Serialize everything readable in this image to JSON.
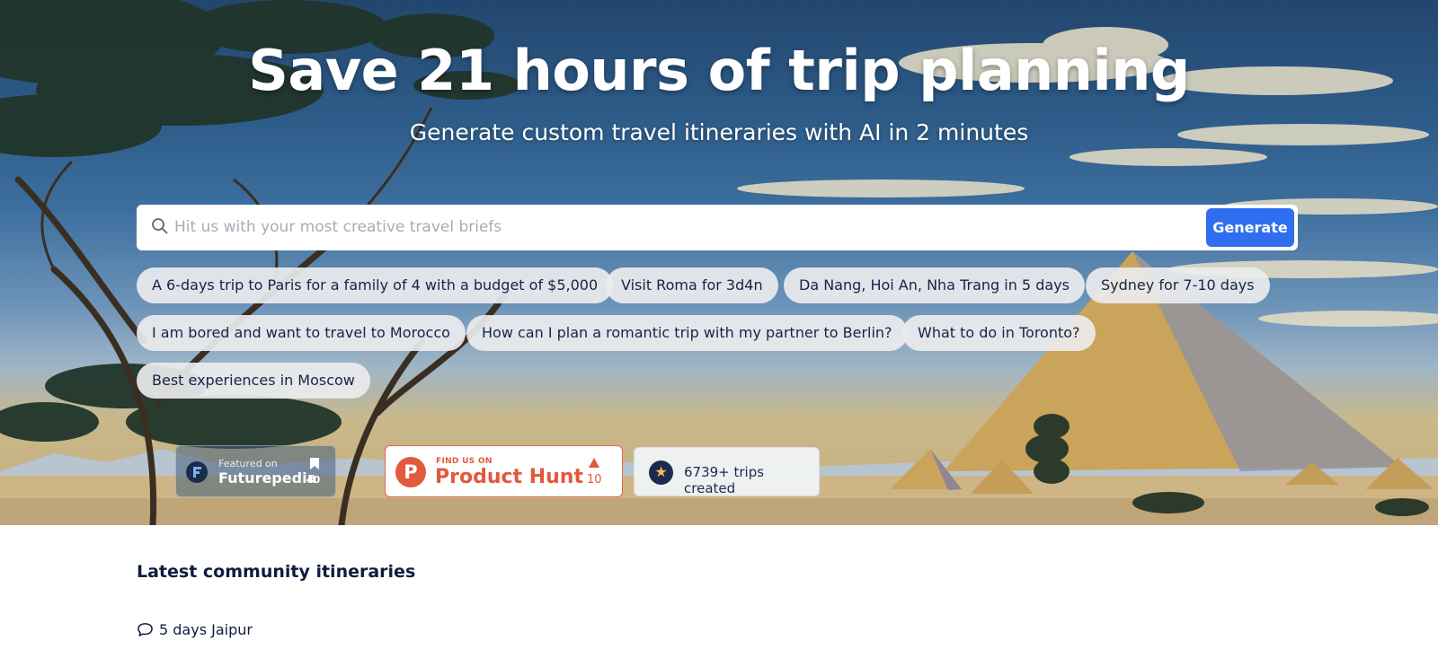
{
  "hero": {
    "title": "Save 21 hours of trip planning",
    "subtitle": "Generate custom travel itineraries with AI in 2 minutes"
  },
  "search": {
    "placeholder": "Hit us with your most creative travel briefs",
    "icon": "search-icon",
    "button_label": "Generate",
    "button_color": "#2f6ef0"
  },
  "suggestions": [
    "A 6-days trip to Paris for a family of 4 with a budget of $5,000",
    "Visit Roma for 3d4n",
    "Da Nang, Hoi An, Nha Trang in 5 days",
    "Sydney for 7-10 days",
    "I am bored and want to travel to Morocco",
    "How can I plan a romantic trip with my partner to Berlin?",
    "What to do in Toronto?",
    "Best experiences in Moscow"
  ],
  "badges": {
    "futurepedia": {
      "small": "Featured on",
      "name": "Futurepedia",
      "count": "40",
      "icon": "bookmark-icon"
    },
    "producthunt": {
      "small": "FIND US ON",
      "name": "Product Hunt",
      "letter": "P",
      "count": "10",
      "icon": "upvote-triangle-icon",
      "color": "#e4583d"
    },
    "trips": {
      "text": "6739+ trips created",
      "icon": "star-icon"
    }
  },
  "community": {
    "heading": "Latest community itineraries",
    "items": [
      {
        "label": "5 days Jaipur",
        "icon": "comment-icon"
      }
    ]
  }
}
